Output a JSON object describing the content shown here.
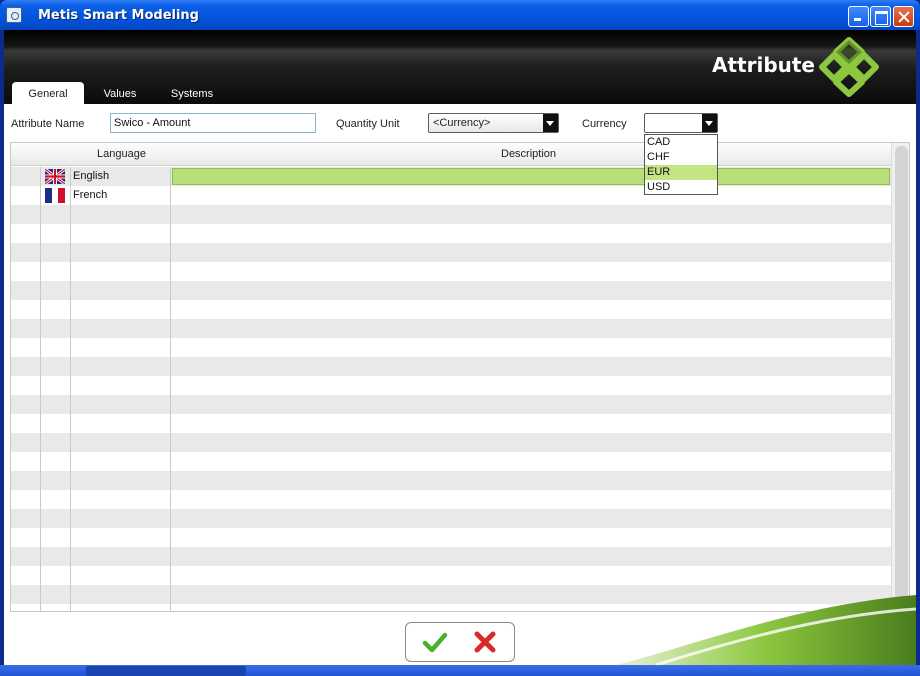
{
  "window": {
    "title": "Metis Smart Modeling",
    "icons": [
      "app-icon",
      "minimize-icon",
      "maximize-icon",
      "close-icon"
    ]
  },
  "header": {
    "title": "Attribute",
    "logo": "metis-logo"
  },
  "tabs": [
    {
      "label": "General",
      "active": true
    },
    {
      "label": "Values",
      "active": false
    },
    {
      "label": "Systems",
      "active": false
    }
  ],
  "form": {
    "attribute_name_label": "Attribute Name",
    "attribute_name_value": "Swico - Amount",
    "quantity_unit_label": "Quantity Unit",
    "quantity_unit_value": "<Currency>",
    "currency_label": "Currency",
    "currency_value": ""
  },
  "currency_dropdown": {
    "options": [
      "CAD",
      "CHF",
      "EUR",
      "USD"
    ],
    "highlighted": "EUR"
  },
  "grid": {
    "columns": [
      "Language",
      "Description"
    ],
    "rows": [
      {
        "language": "English",
        "flag": "uk-flag-icon",
        "description": ""
      },
      {
        "language": "French",
        "flag": "france-flag-icon",
        "description": ""
      }
    ]
  },
  "footer": {
    "ok_icon": "checkmark-icon",
    "cancel_icon": "red-x-icon"
  },
  "colors": {
    "title_bar": "#0454dc",
    "accent_green": "#b9df7a",
    "header_band": "#111111"
  }
}
